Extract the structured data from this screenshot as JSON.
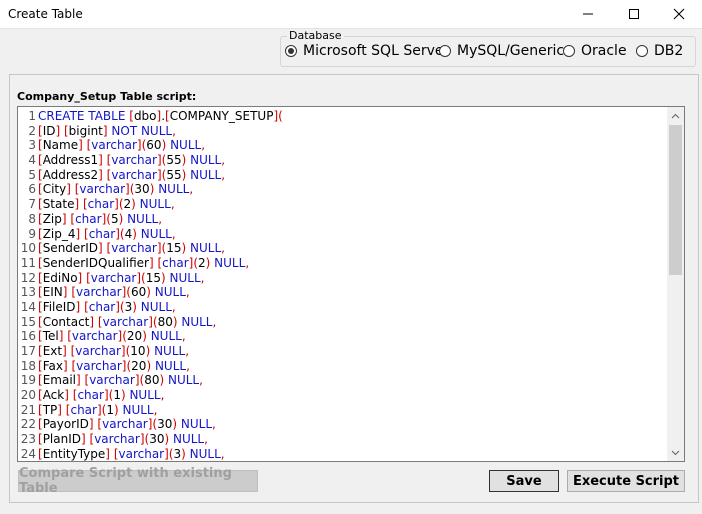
{
  "window": {
    "title": "Create Table"
  },
  "database": {
    "group_label": "Database",
    "options": [
      {
        "label": "Microsoft SQL Server",
        "selected": true
      },
      {
        "label": "MySQL/Generic",
        "selected": false
      },
      {
        "label": "Oracle",
        "selected": false
      },
      {
        "label": "DB2",
        "selected": false
      }
    ]
  },
  "script": {
    "label": "Company_Setup Table script:",
    "lines": [
      [
        [
          "CREATE TABLE",
          "kw"
        ],
        [
          " ",
          ""
        ],
        [
          "[",
          "pn"
        ],
        [
          "dbo",
          "sp"
        ],
        [
          "]",
          "pn"
        ],
        [
          ".",
          "sp"
        ],
        [
          "[",
          "pn"
        ],
        [
          "COMPANY_SETUP",
          "sp"
        ],
        [
          "](",
          "pn"
        ]
      ],
      [
        [
          "[",
          "pn"
        ],
        [
          "ID",
          "sp"
        ],
        [
          "]",
          "pn"
        ],
        [
          " ",
          ""
        ],
        [
          "[",
          "pn"
        ],
        [
          "bigint",
          "sp"
        ],
        [
          "]",
          "pn"
        ],
        [
          " NOT NULL",
          "kw"
        ],
        [
          ",",
          "pn"
        ]
      ],
      [
        [
          "[",
          "pn"
        ],
        [
          "Name",
          "sp"
        ],
        [
          "]",
          "pn"
        ],
        [
          " ",
          ""
        ],
        [
          "[",
          "pn"
        ],
        [
          "varchar",
          "kw"
        ],
        [
          "](",
          "pn"
        ],
        [
          "60",
          "sp"
        ],
        [
          ")",
          "pn"
        ],
        [
          " NULL",
          "kw"
        ],
        [
          ",",
          "pn"
        ]
      ],
      [
        [
          "[",
          "pn"
        ],
        [
          "Address1",
          "sp"
        ],
        [
          "]",
          "pn"
        ],
        [
          " ",
          ""
        ],
        [
          "[",
          "pn"
        ],
        [
          "varchar",
          "kw"
        ],
        [
          "](",
          "pn"
        ],
        [
          "55",
          "sp"
        ],
        [
          ")",
          "pn"
        ],
        [
          " NULL",
          "kw"
        ],
        [
          ",",
          "pn"
        ]
      ],
      [
        [
          "[",
          "pn"
        ],
        [
          "Address2",
          "sp"
        ],
        [
          "]",
          "pn"
        ],
        [
          " ",
          ""
        ],
        [
          "[",
          "pn"
        ],
        [
          "varchar",
          "kw"
        ],
        [
          "](",
          "pn"
        ],
        [
          "55",
          "sp"
        ],
        [
          ")",
          "pn"
        ],
        [
          " NULL",
          "kw"
        ],
        [
          ",",
          "pn"
        ]
      ],
      [
        [
          "[",
          "pn"
        ],
        [
          "City",
          "sp"
        ],
        [
          "]",
          "pn"
        ],
        [
          " ",
          ""
        ],
        [
          "[",
          "pn"
        ],
        [
          "varchar",
          "kw"
        ],
        [
          "](",
          "pn"
        ],
        [
          "30",
          "sp"
        ],
        [
          ")",
          "pn"
        ],
        [
          " NULL",
          "kw"
        ],
        [
          ",",
          "pn"
        ]
      ],
      [
        [
          "[",
          "pn"
        ],
        [
          "State",
          "sp"
        ],
        [
          "]",
          "pn"
        ],
        [
          " ",
          ""
        ],
        [
          "[",
          "pn"
        ],
        [
          "char",
          "kw"
        ],
        [
          "](",
          "pn"
        ],
        [
          "2",
          "sp"
        ],
        [
          ")",
          "pn"
        ],
        [
          " NULL",
          "kw"
        ],
        [
          ",",
          "pn"
        ]
      ],
      [
        [
          "[",
          "pn"
        ],
        [
          "Zip",
          "sp"
        ],
        [
          "]",
          "pn"
        ],
        [
          " ",
          ""
        ],
        [
          "[",
          "pn"
        ],
        [
          "char",
          "kw"
        ],
        [
          "](",
          "pn"
        ],
        [
          "5",
          "sp"
        ],
        [
          ")",
          "pn"
        ],
        [
          " NULL",
          "kw"
        ],
        [
          ",",
          "pn"
        ]
      ],
      [
        [
          "[",
          "pn"
        ],
        [
          "Zip_4",
          "sp"
        ],
        [
          "]",
          "pn"
        ],
        [
          " ",
          ""
        ],
        [
          "[",
          "pn"
        ],
        [
          "char",
          "kw"
        ],
        [
          "](",
          "pn"
        ],
        [
          "4",
          "sp"
        ],
        [
          ")",
          "pn"
        ],
        [
          " NULL",
          "kw"
        ],
        [
          ",",
          "pn"
        ]
      ],
      [
        [
          "[",
          "pn"
        ],
        [
          "SenderID",
          "sp"
        ],
        [
          "]",
          "pn"
        ],
        [
          " ",
          ""
        ],
        [
          "[",
          "pn"
        ],
        [
          "varchar",
          "kw"
        ],
        [
          "](",
          "pn"
        ],
        [
          "15",
          "sp"
        ],
        [
          ")",
          "pn"
        ],
        [
          " NULL",
          "kw"
        ],
        [
          ",",
          "pn"
        ]
      ],
      [
        [
          "[",
          "pn"
        ],
        [
          "SenderIDQualifier",
          "sp"
        ],
        [
          "]",
          "pn"
        ],
        [
          " ",
          ""
        ],
        [
          "[",
          "pn"
        ],
        [
          "char",
          "kw"
        ],
        [
          "](",
          "pn"
        ],
        [
          "2",
          "sp"
        ],
        [
          ")",
          "pn"
        ],
        [
          " NULL",
          "kw"
        ],
        [
          ",",
          "pn"
        ]
      ],
      [
        [
          "[",
          "pn"
        ],
        [
          "EdiNo",
          "sp"
        ],
        [
          "]",
          "pn"
        ],
        [
          " ",
          ""
        ],
        [
          "[",
          "pn"
        ],
        [
          "varchar",
          "kw"
        ],
        [
          "](",
          "pn"
        ],
        [
          "15",
          "sp"
        ],
        [
          ")",
          "pn"
        ],
        [
          " NULL",
          "kw"
        ],
        [
          ",",
          "pn"
        ]
      ],
      [
        [
          "[",
          "pn"
        ],
        [
          "EIN",
          "sp"
        ],
        [
          "]",
          "pn"
        ],
        [
          " ",
          ""
        ],
        [
          "[",
          "pn"
        ],
        [
          "varchar",
          "kw"
        ],
        [
          "](",
          "pn"
        ],
        [
          "60",
          "sp"
        ],
        [
          ")",
          "pn"
        ],
        [
          " NULL",
          "kw"
        ],
        [
          ",",
          "pn"
        ]
      ],
      [
        [
          "[",
          "pn"
        ],
        [
          "FileID",
          "sp"
        ],
        [
          "]",
          "pn"
        ],
        [
          " ",
          ""
        ],
        [
          "[",
          "pn"
        ],
        [
          "char",
          "kw"
        ],
        [
          "](",
          "pn"
        ],
        [
          "3",
          "sp"
        ],
        [
          ")",
          "pn"
        ],
        [
          " NULL",
          "kw"
        ],
        [
          ",",
          "pn"
        ]
      ],
      [
        [
          "[",
          "pn"
        ],
        [
          "Contact",
          "sp"
        ],
        [
          "]",
          "pn"
        ],
        [
          " ",
          ""
        ],
        [
          "[",
          "pn"
        ],
        [
          "varchar",
          "kw"
        ],
        [
          "](",
          "pn"
        ],
        [
          "80",
          "sp"
        ],
        [
          ")",
          "pn"
        ],
        [
          " NULL",
          "kw"
        ],
        [
          ",",
          "pn"
        ]
      ],
      [
        [
          "[",
          "pn"
        ],
        [
          "Tel",
          "sp"
        ],
        [
          "]",
          "pn"
        ],
        [
          " ",
          ""
        ],
        [
          "[",
          "pn"
        ],
        [
          "varchar",
          "kw"
        ],
        [
          "](",
          "pn"
        ],
        [
          "20",
          "sp"
        ],
        [
          ")",
          "pn"
        ],
        [
          " NULL",
          "kw"
        ],
        [
          ",",
          "pn"
        ]
      ],
      [
        [
          "[",
          "pn"
        ],
        [
          "Ext",
          "sp"
        ],
        [
          "]",
          "pn"
        ],
        [
          " ",
          ""
        ],
        [
          "[",
          "pn"
        ],
        [
          "varchar",
          "kw"
        ],
        [
          "](",
          "pn"
        ],
        [
          "10",
          "sp"
        ],
        [
          ")",
          "pn"
        ],
        [
          " NULL",
          "kw"
        ],
        [
          ",",
          "pn"
        ]
      ],
      [
        [
          "[",
          "pn"
        ],
        [
          "Fax",
          "sp"
        ],
        [
          "]",
          "pn"
        ],
        [
          " ",
          ""
        ],
        [
          "[",
          "pn"
        ],
        [
          "varchar",
          "kw"
        ],
        [
          "](",
          "pn"
        ],
        [
          "20",
          "sp"
        ],
        [
          ")",
          "pn"
        ],
        [
          " NULL",
          "kw"
        ],
        [
          ",",
          "pn"
        ]
      ],
      [
        [
          "[",
          "pn"
        ],
        [
          "Email",
          "sp"
        ],
        [
          "]",
          "pn"
        ],
        [
          " ",
          ""
        ],
        [
          "[",
          "pn"
        ],
        [
          "varchar",
          "kw"
        ],
        [
          "](",
          "pn"
        ],
        [
          "80",
          "sp"
        ],
        [
          ")",
          "pn"
        ],
        [
          " NULL",
          "kw"
        ],
        [
          ",",
          "pn"
        ]
      ],
      [
        [
          "[",
          "pn"
        ],
        [
          "Ack",
          "sp"
        ],
        [
          "]",
          "pn"
        ],
        [
          " ",
          ""
        ],
        [
          "[",
          "pn"
        ],
        [
          "char",
          "kw"
        ],
        [
          "](",
          "pn"
        ],
        [
          "1",
          "sp"
        ],
        [
          ")",
          "pn"
        ],
        [
          " NULL",
          "kw"
        ],
        [
          ",",
          "pn"
        ]
      ],
      [
        [
          "[",
          "pn"
        ],
        [
          "TP",
          "sp"
        ],
        [
          "]",
          "pn"
        ],
        [
          " ",
          ""
        ],
        [
          "[",
          "pn"
        ],
        [
          "char",
          "kw"
        ],
        [
          "](",
          "pn"
        ],
        [
          "1",
          "sp"
        ],
        [
          ")",
          "pn"
        ],
        [
          " NULL",
          "kw"
        ],
        [
          ",",
          "pn"
        ]
      ],
      [
        [
          "[",
          "pn"
        ],
        [
          "PayorID",
          "sp"
        ],
        [
          "]",
          "pn"
        ],
        [
          " ",
          ""
        ],
        [
          "[",
          "pn"
        ],
        [
          "varchar",
          "kw"
        ],
        [
          "](",
          "pn"
        ],
        [
          "30",
          "sp"
        ],
        [
          ")",
          "pn"
        ],
        [
          " NULL",
          "kw"
        ],
        [
          ",",
          "pn"
        ]
      ],
      [
        [
          "[",
          "pn"
        ],
        [
          "PlanID",
          "sp"
        ],
        [
          "]",
          "pn"
        ],
        [
          " ",
          ""
        ],
        [
          "[",
          "pn"
        ],
        [
          "varchar",
          "kw"
        ],
        [
          "](",
          "pn"
        ],
        [
          "30",
          "sp"
        ],
        [
          ")",
          "pn"
        ],
        [
          " NULL",
          "kw"
        ],
        [
          ",",
          "pn"
        ]
      ],
      [
        [
          "[",
          "pn"
        ],
        [
          "EntityType",
          "sp"
        ],
        [
          "]",
          "pn"
        ],
        [
          " ",
          ""
        ],
        [
          "[",
          "pn"
        ],
        [
          "varchar",
          "kw"
        ],
        [
          "](",
          "pn"
        ],
        [
          "3",
          "sp"
        ],
        [
          ")",
          "pn"
        ],
        [
          " NULL",
          "kw"
        ],
        [
          ",",
          "pn"
        ]
      ]
    ]
  },
  "buttons": {
    "compare": "Compare Script with existing Table",
    "save": "Save",
    "execute": "Execute Script"
  },
  "icons": {
    "minimize": "minimize-icon",
    "maximize": "maximize-icon",
    "close": "close-icon",
    "scroll_up": "chevron-up-icon",
    "scroll_down": "chevron-down-icon"
  },
  "colors": {
    "keyword": "#1515c8",
    "punctuation": "#d00000",
    "text": "#000000"
  }
}
